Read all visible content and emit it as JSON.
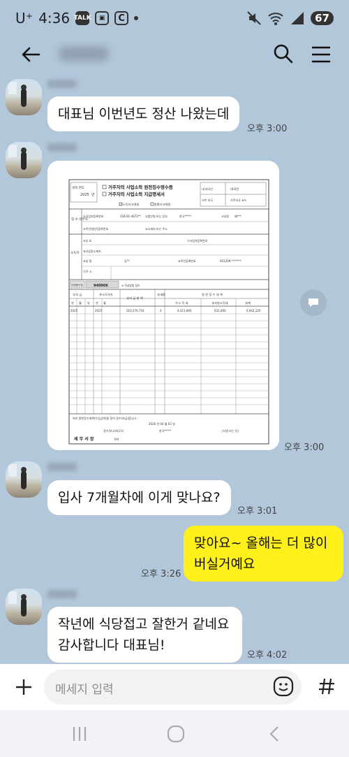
{
  "status_bar": {
    "carrier": "U⁺",
    "time": "4:36",
    "app_icons": [
      "talk-icon",
      "screenshot-icon",
      "c-app-icon"
    ],
    "battery": "67"
  },
  "chat": {
    "messages": [
      {
        "sender": "other",
        "text": "대표님 이번년도 정산 나왔는데",
        "time": "오후 3:00"
      },
      {
        "sender": "other",
        "type": "image",
        "time": "오후 3:00"
      },
      {
        "sender": "other",
        "text": "입사 7개월차에 이게 맞나요?",
        "time": "오후 3:01"
      },
      {
        "sender": "me",
        "lines": [
          "맞아요~ 올해는 더 많이",
          "버실거예요"
        ],
        "time": "오후 3:26"
      },
      {
        "sender": "other",
        "lines": [
          "작년에 식당접고 잘한거 같네요",
          "감사합니다 대표님!"
        ],
        "time": "오후 4:02"
      }
    ]
  },
  "document": {
    "title_line1": "거주자의 사업소득 원천징수영수증",
    "title_line2": "거주자의 사업소득 지급명세서",
    "year_label": "귀속 연도",
    "year": "2025",
    "unit": "년",
    "receiver_copy": "소득자 보관용",
    "payer_copy": "발행자 보관용",
    "resident_label": "내·외국인",
    "resident_value": "내국인",
    "residence_label": "거주 지국",
    "residence_code_label": "거주지국 코드",
    "biz_reg_label": "①사업자등록번호",
    "biz_reg_value": "104-81-4672**",
    "corp_name_label": "②법인명 또는 상호",
    "corp_name_value": "한국*****",
    "name_label": "③성명",
    "name_value": "배***",
    "resident_no_label": "④주민(법인)등록번호",
    "address_label": "⑤소재지 또는 주소",
    "payer_side_label": "징 수 의무자",
    "earner_label": "소득자",
    "trade_name_label": "⑥상 호",
    "biz_no_label": "⑦사업자등록번호",
    "biz_place_label": "⑧사업장소재지",
    "earner_name_label": "⑨성 명",
    "earner_name_value": "김**",
    "earner_id_label": "⑩주민등록번호",
    "earner_id_value": "951209-*******",
    "earner_addr_label": "⑪주 소",
    "type_label": "⑫업종구분",
    "type_value": "940906",
    "type_note": "※ 작성방법 참조",
    "col_pay_year": "⑬지 급",
    "col_income_year": "⑭소득귀속",
    "col_pay_amount": "⑮지 급 총 액",
    "col_rate": "⑯세율",
    "col_withholding": "원 천 징 수 세 액",
    "col_income_tax": "⑰소 득 세",
    "col_local_tax": "⑱지방소득세",
    "col_total": "⑲계",
    "sub_year": "연",
    "sub_month": "월",
    "sub_day": "일",
    "row_pay_year": "2025",
    "row_income_year": "2025",
    "row_amount": "210,370,710",
    "row_rate": "3",
    "row_income_tax": "6,311,060",
    "row_local_tax": "631,060",
    "row_total": "6,942,120",
    "footer_text": "위의 원천징수세액(수입금액)을 정히 영수(지급)합니다.",
    "footer_date": "2026 년 04 월 03 일",
    "footer_payer_label": "징수(보고)의무자",
    "footer_payer_value": "한국*****",
    "footer_sign": "(서명 또는 인)",
    "footer_office": "세 무 서 장",
    "footer_honorific": "귀하"
  },
  "input_bar": {
    "placeholder": "메세지 입력"
  }
}
